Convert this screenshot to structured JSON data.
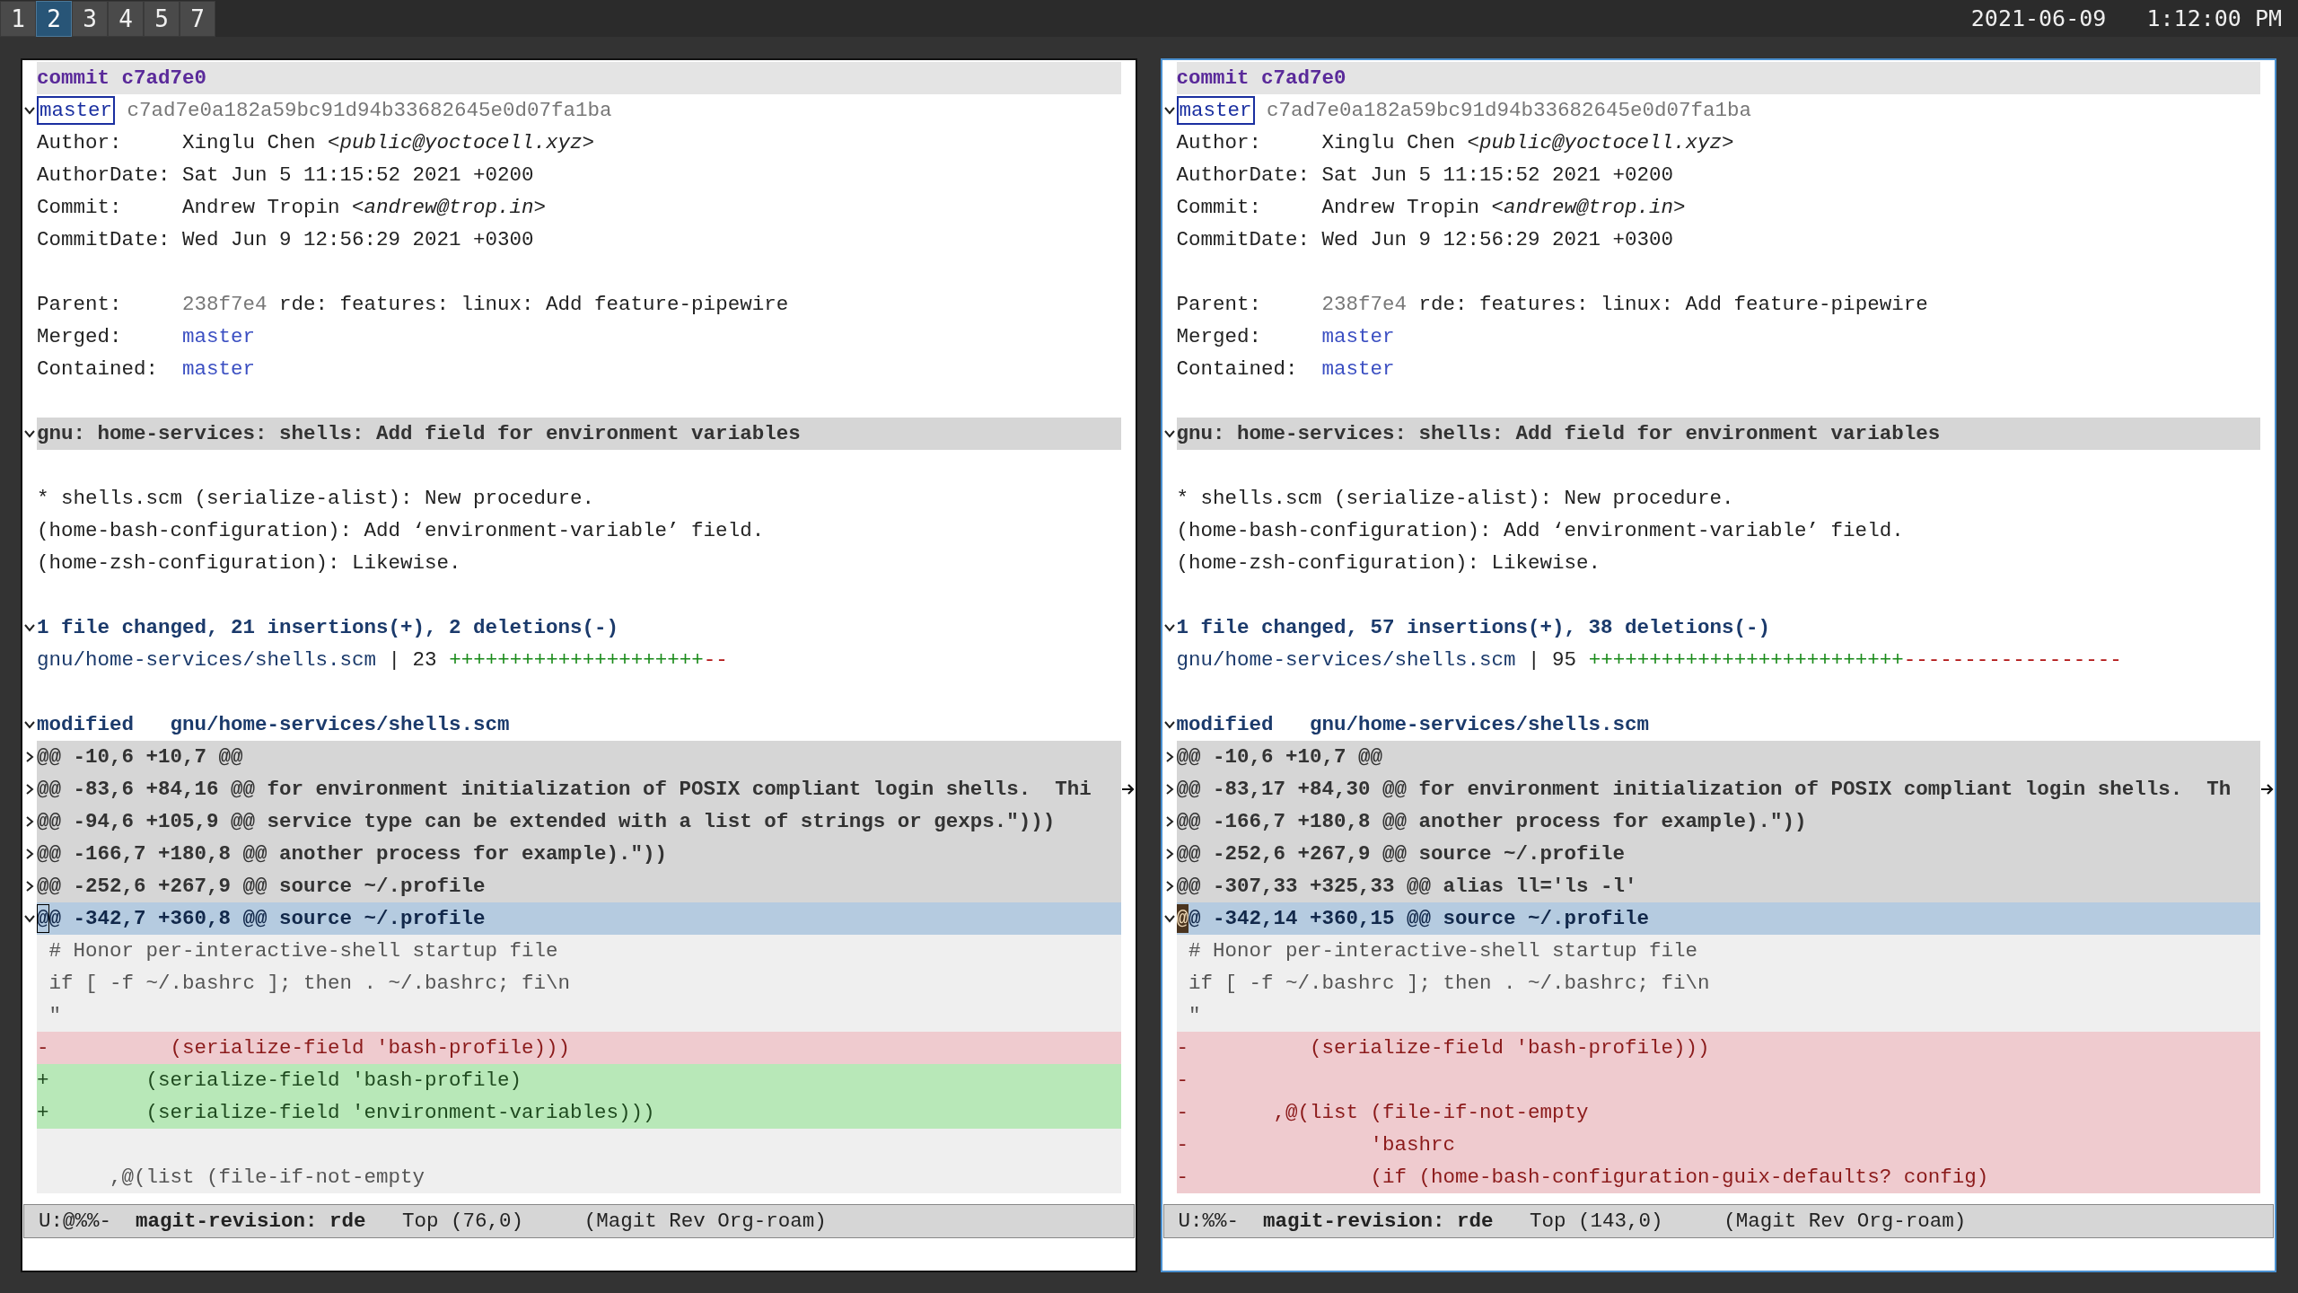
{
  "topbar": {
    "workspaces": [
      {
        "label": "1",
        "selected": false
      },
      {
        "label": "2",
        "selected": true
      },
      {
        "label": "3",
        "selected": false
      },
      {
        "label": "4",
        "selected": false
      },
      {
        "label": "5",
        "selected": false
      },
      {
        "label": "7",
        "selected": false
      }
    ],
    "clock": "2021-06-09   1:12:00 PM"
  },
  "panes": [
    {
      "active": false,
      "lines": [
        {
          "kind": "commit-heading",
          "text": "commit c7ad7e0"
        },
        {
          "kind": "refs",
          "expanded": true,
          "branch": "master",
          "hash": "c7ad7e0a182a59bc91d94b33682645e0d07fa1ba"
        },
        {
          "kind": "header",
          "label": "Author:",
          "value": "Xinglu Chen <*public@yoctocell.xyz*>"
        },
        {
          "kind": "header",
          "label": "AuthorDate:",
          "value": "Sat Jun 5 11:15:52 2021 +0200"
        },
        {
          "kind": "header",
          "label": "Commit:",
          "value": "Andrew Tropin <*andrew@trop.in*>"
        },
        {
          "kind": "header",
          "label": "CommitDate:",
          "value": "Wed Jun 9 12:56:29 2021 +0300"
        },
        {
          "kind": "blank"
        },
        {
          "kind": "parent",
          "label": "Parent:",
          "hash": "238f7e4",
          "text": "rde: features: linux: Add feature-pipewire"
        },
        {
          "kind": "link",
          "label": "Merged:",
          "value": "master"
        },
        {
          "kind": "link",
          "label": "Contained:",
          "value": "master"
        },
        {
          "kind": "blank"
        },
        {
          "kind": "section",
          "expanded": true,
          "text": "gnu: home-services: shells: Add field for environment variables"
        },
        {
          "kind": "blank"
        },
        {
          "kind": "text",
          "text": "* shells.scm (serialize-alist): New procedure."
        },
        {
          "kind": "text",
          "text": "(home-bash-configuration): Add ‘environment-variable’ field."
        },
        {
          "kind": "text",
          "text": "(home-zsh-configuration): Likewise."
        },
        {
          "kind": "blank"
        },
        {
          "kind": "stat-heading",
          "expanded": true,
          "text": "1 file changed, 21 insertions(+), 2 deletions(-)"
        },
        {
          "kind": "stat",
          "file": "gnu/home-services/shells.scm",
          "separator": "|",
          "count": "23",
          "plus": "+++++++++++++++++++++",
          "minus": "--"
        },
        {
          "kind": "blank"
        },
        {
          "kind": "file-heading",
          "expanded": true,
          "status": "modified",
          "file": "gnu/home-services/shells.scm"
        },
        {
          "kind": "hunk",
          "expanded": false,
          "selected": false,
          "text": "@@ -10,6 +10,7 @@"
        },
        {
          "kind": "hunk",
          "expanded": false,
          "selected": false,
          "truncated": true,
          "text": "@@ -83,6 +84,16 @@ for environment initialization of POSIX compliant login shells.  Thi"
        },
        {
          "kind": "hunk",
          "expanded": false,
          "selected": false,
          "text": "@@ -94,6 +105,9 @@ service type can be extended with a list of strings or gexps.\")))"
        },
        {
          "kind": "hunk",
          "expanded": false,
          "selected": false,
          "text": "@@ -166,7 +180,8 @@ another process for example).\"))"
        },
        {
          "kind": "hunk",
          "expanded": false,
          "selected": false,
          "text": "@@ -252,6 +267,9 @@ source ~/.profile"
        },
        {
          "kind": "hunk",
          "expanded": true,
          "selected": true,
          "cursor": true,
          "text": "@@ -342,7 +360,8 @@ source ~/.profile"
        },
        {
          "kind": "context",
          "text": " # Honor per-interactive-shell startup file"
        },
        {
          "kind": "context",
          "text": " if [ -f ~/.bashrc ]; then . ~/.bashrc; fi\\n"
        },
        {
          "kind": "context",
          "text": " \""
        },
        {
          "kind": "removed",
          "text": "-          (serialize-field 'bash-profile)))"
        },
        {
          "kind": "added",
          "text": "+        (serialize-field 'bash-profile)"
        },
        {
          "kind": "added",
          "text": "+        (serialize-field 'environment-variables)))"
        },
        {
          "kind": "context-blank"
        },
        {
          "kind": "context",
          "text": "      ,@(list (file-if-not-empty"
        }
      ],
      "modeline": {
        "state": "U:@%%-",
        "buffer": "magit-revision: rde",
        "position": "Top (76,0)",
        "modes": "(Magit Rev Org-roam)"
      }
    },
    {
      "active": true,
      "lines": [
        {
          "kind": "commit-heading",
          "text": "commit c7ad7e0"
        },
        {
          "kind": "refs",
          "expanded": true,
          "branch": "master",
          "hash": "c7ad7e0a182a59bc91d94b33682645e0d07fa1ba"
        },
        {
          "kind": "header",
          "label": "Author:",
          "value": "Xinglu Chen <*public@yoctocell.xyz*>"
        },
        {
          "kind": "header",
          "label": "AuthorDate:",
          "value": "Sat Jun 5 11:15:52 2021 +0200"
        },
        {
          "kind": "header",
          "label": "Commit:",
          "value": "Andrew Tropin <*andrew@trop.in*>"
        },
        {
          "kind": "header",
          "label": "CommitDate:",
          "value": "Wed Jun 9 12:56:29 2021 +0300"
        },
        {
          "kind": "blank"
        },
        {
          "kind": "parent",
          "label": "Parent:",
          "hash": "238f7e4",
          "text": "rde: features: linux: Add feature-pipewire"
        },
        {
          "kind": "link",
          "label": "Merged:",
          "value": "master"
        },
        {
          "kind": "link",
          "label": "Contained:",
          "value": "master"
        },
        {
          "kind": "blank"
        },
        {
          "kind": "section",
          "expanded": true,
          "text": "gnu: home-services: shells: Add field for environment variables"
        },
        {
          "kind": "blank"
        },
        {
          "kind": "text",
          "text": "* shells.scm (serialize-alist): New procedure."
        },
        {
          "kind": "text",
          "text": "(home-bash-configuration): Add ‘environment-variable’ field."
        },
        {
          "kind": "text",
          "text": "(home-zsh-configuration): Likewise."
        },
        {
          "kind": "blank"
        },
        {
          "kind": "stat-heading",
          "expanded": true,
          "text": "1 file changed, 57 insertions(+), 38 deletions(-)"
        },
        {
          "kind": "stat",
          "file": "gnu/home-services/shells.scm",
          "separator": "|",
          "count": "95",
          "plus": "++++++++++++++++++++++++++",
          "minus": "------------------"
        },
        {
          "kind": "blank"
        },
        {
          "kind": "file-heading",
          "expanded": true,
          "status": "modified",
          "file": "gnu/home-services/shells.scm"
        },
        {
          "kind": "hunk",
          "expanded": false,
          "selected": false,
          "text": "@@ -10,6 +10,7 @@"
        },
        {
          "kind": "hunk",
          "expanded": false,
          "selected": false,
          "truncated": true,
          "text": "@@ -83,17 +84,30 @@ for environment initialization of POSIX compliant login shells.  Th"
        },
        {
          "kind": "hunk",
          "expanded": false,
          "selected": false,
          "text": "@@ -166,7 +180,8 @@ another process for example).\"))"
        },
        {
          "kind": "hunk",
          "expanded": false,
          "selected": false,
          "text": "@@ -252,6 +267,9 @@ source ~/.profile"
        },
        {
          "kind": "hunk",
          "expanded": false,
          "selected": false,
          "text": "@@ -307,33 +325,33 @@ alias ll='ls -l'"
        },
        {
          "kind": "hunk",
          "expanded": true,
          "selected": true,
          "cursor": true,
          "text": "@@ -342,14 +360,15 @@ source ~/.profile"
        },
        {
          "kind": "context",
          "text": " # Honor per-interactive-shell startup file"
        },
        {
          "kind": "context",
          "text": " if [ -f ~/.bashrc ]; then . ~/.bashrc; fi\\n"
        },
        {
          "kind": "context",
          "text": " \""
        },
        {
          "kind": "removed",
          "text": "-          (serialize-field 'bash-profile)))"
        },
        {
          "kind": "removed",
          "text": "-"
        },
        {
          "kind": "removed",
          "text": "-       ,@(list (file-if-not-empty"
        },
        {
          "kind": "removed",
          "text": "-               'bashrc"
        },
        {
          "kind": "removed",
          "text": "-               (if (home-bash-configuration-guix-defaults? config)"
        }
      ],
      "modeline": {
        "state": "U:%%-",
        "buffer": "magit-revision: rde",
        "position": "Top (143,0)",
        "modes": "(Magit Rev Org-roam)"
      }
    }
  ]
}
